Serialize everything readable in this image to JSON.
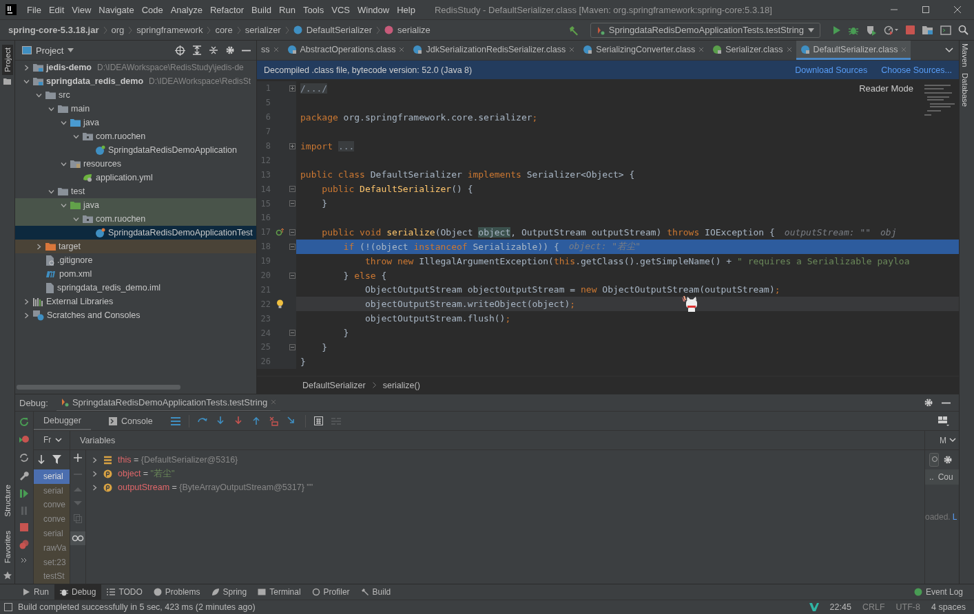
{
  "menu_bar": {
    "items": [
      "File",
      "Edit",
      "View",
      "Navigate",
      "Code",
      "Analyze",
      "Refactor",
      "Build",
      "Run",
      "Tools",
      "VCS",
      "Window",
      "Help"
    ],
    "title": "RedisStudy - DefaultSerializer.class [Maven: org.springframework:spring-core:5.3.18]"
  },
  "nav_bar": {
    "breadcrumb": [
      {
        "label": "spring-core-5.3.18.jar",
        "kind": "jar"
      },
      {
        "label": "org",
        "kind": "package"
      },
      {
        "label": "springframework",
        "kind": "package"
      },
      {
        "label": "core",
        "kind": "package"
      },
      {
        "label": "serializer",
        "kind": "package"
      },
      {
        "label": "DefaultSerializer",
        "kind": "class"
      },
      {
        "label": "serialize",
        "kind": "method"
      }
    ],
    "run_config": "SpringdataRedisDemoApplicationTests.testString"
  },
  "left_stripe": {
    "top": [
      "Project"
    ],
    "bottom": [
      "Structure",
      "Favorites"
    ]
  },
  "right_stripe": [
    "Maven",
    "Database"
  ],
  "project_panel": {
    "title": "Project",
    "tree": [
      {
        "label": "jedis-demo",
        "path": "D:\\IDEAWorkspace\\RedisStudy\\jedis-de",
        "kind": "module",
        "expanded": false,
        "selected": false
      },
      {
        "label": "springdata_redis_demo",
        "path": "D:\\IDEAWorkspace\\RedisSt",
        "kind": "module",
        "expanded": true,
        "selected": false,
        "children": [
          {
            "label": "src",
            "kind": "folder",
            "expanded": true,
            "selected": false,
            "children": [
              {
                "label": "main",
                "kind": "folder",
                "expanded": true,
                "selected": false,
                "children": [
                  {
                    "label": "java",
                    "kind": "source-root",
                    "expanded": true,
                    "selected": false,
                    "children": [
                      {
                        "label": "com.ruochen",
                        "kind": "package",
                        "expanded": true,
                        "selected": false,
                        "children": [
                          {
                            "label": "SpringdataRedisDemoApplication",
                            "kind": "spring-class",
                            "selected": false
                          }
                        ]
                      }
                    ]
                  },
                  {
                    "label": "resources",
                    "kind": "resource-root",
                    "expanded": true,
                    "selected": false,
                    "children": [
                      {
                        "label": "application.yml",
                        "kind": "yml",
                        "selected": false
                      }
                    ]
                  }
                ]
              },
              {
                "label": "test",
                "kind": "folder",
                "expanded": true,
                "selected": false,
                "children": [
                  {
                    "label": "java",
                    "kind": "test-root",
                    "expanded": true,
                    "selected": false,
                    "children": [
                      {
                        "label": "com.ruochen",
                        "kind": "package",
                        "expanded": true,
                        "selected": false,
                        "children": [
                          {
                            "label": "SpringdataRedisDemoApplicationTest",
                            "kind": "test-class",
                            "selected": true
                          }
                        ]
                      }
                    ]
                  }
                ]
              }
            ]
          },
          {
            "label": "target",
            "kind": "excluded-folder",
            "expanded": false,
            "selected": false
          },
          {
            "label": ".gitignore",
            "kind": "ignore-file",
            "selected": false
          },
          {
            "label": "pom.xml",
            "kind": "maven",
            "selected": false
          },
          {
            "label": "springdata_redis_demo.iml",
            "kind": "file",
            "selected": false
          }
        ]
      },
      {
        "label": "External Libraries",
        "kind": "libraries",
        "expanded": false,
        "selected": false
      },
      {
        "label": "Scratches and Consoles",
        "kind": "scratches",
        "expanded": false,
        "selected": false
      }
    ]
  },
  "editor": {
    "tabs": [
      {
        "label": "ss",
        "kind": "none",
        "selected": false
      },
      {
        "label": "AbstractOperations.class",
        "kind": "class",
        "selected": false
      },
      {
        "label": "JdkSerializationRedisSerializer.class",
        "kind": "class",
        "selected": false
      },
      {
        "label": "SerializingConverter.class",
        "kind": "class",
        "selected": false
      },
      {
        "label": "Serializer.class",
        "kind": "interface",
        "selected": false
      },
      {
        "label": "DefaultSerializer.class",
        "kind": "class",
        "selected": true
      }
    ],
    "banner": {
      "text": "Decompiled .class file, bytecode version: 52.0 (Java 8)",
      "links": [
        "Download Sources",
        "Choose Sources..."
      ]
    },
    "reader_mode": "Reader Mode",
    "lines": [
      {
        "num": "1",
        "kind": "plain",
        "folded": true,
        "selected": false,
        "current": false,
        "tokens": [
          {
            "text": "/.../",
            "kind": "fold"
          }
        ]
      },
      {
        "num": "5",
        "kind": "plain",
        "selected": false,
        "current": false
      },
      {
        "num": "6",
        "kind": "plain",
        "selected": false,
        "current": false,
        "tokens": [
          {
            "text": "package",
            "kind": "kw"
          },
          {
            "text": " org.springframework.core.serializer",
            "kind": "plain"
          },
          {
            "text": ";",
            "kind": "kw"
          }
        ]
      },
      {
        "num": "7",
        "kind": "plain",
        "selected": false,
        "current": false
      },
      {
        "num": "8",
        "kind": "plain",
        "folded": true,
        "selected": false,
        "current": false,
        "tokens": [
          {
            "text": "import",
            "kind": "kw"
          },
          {
            "text": "...",
            "kind": "fold"
          }
        ]
      },
      {
        "num": "12",
        "kind": "plain",
        "selected": false,
        "current": false
      },
      {
        "num": "13",
        "kind": "plain",
        "selected": false,
        "current": false,
        "tokens": [
          {
            "text": "public class",
            "kind": "kw"
          },
          {
            "text": " DefaultSerializer ",
            "kind": "plain"
          },
          {
            "text": "implements",
            "kind": "kw"
          },
          {
            "text": " Serializer<Object> {",
            "kind": "plain"
          }
        ]
      },
      {
        "num": "14",
        "kind": "plain",
        "folded": false,
        "selected": false,
        "current": false,
        "tokens": [
          {
            "text": "    public",
            "kind": "kw"
          },
          {
            "text": " DefaultSerializer",
            "kind": "fn"
          },
          {
            "text": "() {",
            "kind": "plain"
          }
        ]
      },
      {
        "num": "15",
        "kind": "plain",
        "folded": false,
        "selected": false,
        "current": false,
        "tokens": [
          {
            "text": "    }",
            "kind": "plain"
          }
        ]
      },
      {
        "num": "16",
        "kind": "plain",
        "selected": false,
        "current": false
      },
      {
        "num": "17",
        "kind": "override",
        "folded": false,
        "selected": false,
        "current": false,
        "tokens": [
          {
            "text": "    public void",
            "kind": "kw"
          },
          {
            "text": " serialize",
            "kind": "fn"
          },
          {
            "text": "(Object ",
            "kind": "plain"
          },
          {
            "text": "object",
            "kind": "param"
          },
          {
            "text": ", OutputStream outputStream) ",
            "kind": "plain"
          },
          {
            "text": "throws",
            "kind": "kw"
          },
          {
            "text": " IOException {",
            "kind": "plain"
          },
          {
            "text": "outputStream: \"\"",
            "kind": "hint"
          },
          {
            "text": "obj",
            "kind": "hint"
          }
        ]
      },
      {
        "num": "18",
        "kind": "plain",
        "folded": false,
        "selected": true,
        "current": false,
        "tokens": [
          {
            "text": "        if",
            "kind": "kw"
          },
          {
            "text": " (!(object ",
            "kind": "plain"
          },
          {
            "text": "instanceof",
            "kind": "kw"
          },
          {
            "text": " Serializable)) {",
            "kind": "plain"
          },
          {
            "text": "object: \"若尘\"",
            "kind": "hint"
          }
        ]
      },
      {
        "num": "19",
        "kind": "plain",
        "selected": false,
        "current": false,
        "tokens": [
          {
            "text": "            throw new",
            "kind": "kw"
          },
          {
            "text": " IllegalArgumentException(",
            "kind": "plain"
          },
          {
            "text": "this",
            "kind": "kw"
          },
          {
            "text": ".getClass().getSimpleName() + ",
            "kind": "plain"
          },
          {
            "text": "\" requires a Serializable payloa",
            "kind": "str"
          }
        ]
      },
      {
        "num": "20",
        "kind": "plain",
        "folded": false,
        "selected": false,
        "current": false,
        "tokens": [
          {
            "text": "        } ",
            "kind": "plain"
          },
          {
            "text": "else",
            "kind": "kw"
          },
          {
            "text": " {",
            "kind": "plain"
          }
        ]
      },
      {
        "num": "21",
        "kind": "plain",
        "selected": false,
        "current": false,
        "tokens": [
          {
            "text": "            ObjectOutputStream objectOutputStream = ",
            "kind": "plain"
          },
          {
            "text": "new",
            "kind": "kw"
          },
          {
            "text": " ObjectOutputStream(outputStream)",
            "kind": "plain"
          },
          {
            "text": ";",
            "kind": "kw"
          }
        ]
      },
      {
        "num": "22",
        "kind": "bulb",
        "selected": false,
        "current": true,
        "tokens": [
          {
            "text": "            objectOutputStream.writeObject(object)",
            "kind": "plain"
          },
          {
            "text": ";",
            "kind": "kw"
          }
        ]
      },
      {
        "num": "23",
        "kind": "plain",
        "selected": false,
        "current": false,
        "tokens": [
          {
            "text": "            objectOutputStream.flush()",
            "kind": "plain"
          },
          {
            "text": ";",
            "kind": "kw"
          }
        ]
      },
      {
        "num": "24",
        "kind": "plain",
        "folded": false,
        "selected": false,
        "current": false,
        "tokens": [
          {
            "text": "        }",
            "kind": "plain"
          }
        ]
      },
      {
        "num": "25",
        "kind": "plain",
        "folded": false,
        "selected": false,
        "current": false,
        "tokens": [
          {
            "text": "    }",
            "kind": "plain"
          }
        ]
      },
      {
        "num": "26",
        "kind": "plain",
        "selected": false,
        "current": false,
        "tokens": [
          {
            "text": "}",
            "kind": "plain"
          }
        ]
      }
    ],
    "breadcrumb": [
      "DefaultSerializer",
      "serialize()"
    ]
  },
  "debug": {
    "label": "Debug:",
    "session": "SpringdataRedisDemoApplicationTests.testString",
    "tabs": [
      {
        "label": "Debugger",
        "selected": true
      },
      {
        "label": "Console",
        "selected": false
      }
    ],
    "frames_label": "Fr",
    "variables_label": "Variables",
    "frames": [
      {
        "label": "serial",
        "selected": true
      },
      {
        "label": "serial",
        "selected": false
      },
      {
        "label": "conve",
        "selected": false
      },
      {
        "label": "conve",
        "selected": false
      },
      {
        "label": "serial",
        "selected": false
      },
      {
        "label": "rawVa",
        "selected": false
      },
      {
        "label": "set:23",
        "selected": false
      },
      {
        "label": "testSt",
        "selected": false
      }
    ],
    "variables": [
      {
        "kind": "this",
        "name": "this",
        "sign": "=",
        "value": "{DefaultSerializer@5316}"
      },
      {
        "kind": "string-param",
        "name": "object",
        "sign": "=",
        "value": "\"若尘\""
      },
      {
        "kind": "object-param",
        "name": "outputStream",
        "sign": "=",
        "value": "{ByteArrayOutputStream@5317} \"\""
      }
    ],
    "side_panel": {
      "label": "M",
      "dots": "..",
      "column": "Cou",
      "message": "oaded.",
      "link": "L"
    }
  },
  "tool_windows": [
    {
      "label": "Run",
      "kind": "run",
      "selected": false
    },
    {
      "label": "Debug",
      "kind": "debug",
      "selected": true
    },
    {
      "label": "TODO",
      "kind": "todo",
      "selected": false
    },
    {
      "label": "Problems",
      "kind": "problems",
      "selected": false
    },
    {
      "label": "Spring",
      "kind": "spring",
      "selected": false
    },
    {
      "label": "Terminal",
      "kind": "terminal",
      "selected": false
    },
    {
      "label": "Profiler",
      "kind": "profiler",
      "selected": false
    },
    {
      "label": "Build",
      "kind": "build",
      "selected": false
    }
  ],
  "event_log": "Event Log",
  "status_bar": {
    "message": "Build completed successfully in 5 sec, 423 ms (2 minutes ago)",
    "position": "22:45",
    "line_separator": "CRLF",
    "encoding": "UTF-8",
    "indent": "4 spaces"
  }
}
